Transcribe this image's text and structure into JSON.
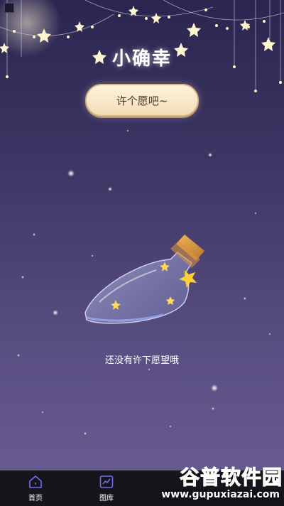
{
  "app": {
    "title": "小确幸"
  },
  "actions": {
    "wish_button_label": "许个愿吧~"
  },
  "main": {
    "empty_message": "还没有许下愿望哦"
  },
  "tabs": [
    {
      "label": "首页",
      "icon": "home-icon"
    },
    {
      "label": "图库",
      "icon": "chart-icon"
    }
  ],
  "watermark": {
    "brand": "谷普软件园",
    "url": "www.gupuxiazai.com"
  },
  "colors": {
    "background_top": "#2b2550",
    "background_bottom": "#6b5e94",
    "tabbar": "#17151c",
    "button_fill": "#f2dcb6",
    "button_text": "#4b3526",
    "tab_icon": "#6f6cf0",
    "watermark_green": "#5cc94a"
  }
}
